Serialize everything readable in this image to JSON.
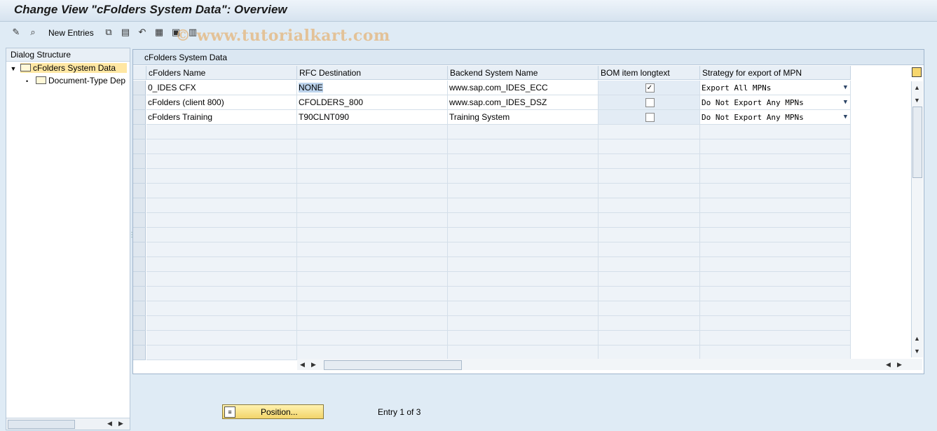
{
  "window": {
    "title": "Change View \"cFolders System Data\": Overview"
  },
  "toolbar": {
    "new_entries": "New Entries",
    "watermark": "© www.tutorialkart.com"
  },
  "dialog": {
    "header": "Dialog Structure",
    "items": [
      {
        "label": "cFolders System Data"
      },
      {
        "label": "Document-Type Dep"
      }
    ]
  },
  "table": {
    "title": "cFolders System Data",
    "columns": [
      "cFolders Name",
      "RFC Destination",
      "Backend System Name",
      "BOM item longtext",
      "Strategy for export of MPN"
    ],
    "rows": [
      {
        "name": "0_IDES CFX",
        "rfc": "NONE",
        "backend": "www.sap.com_IDES_ECC",
        "bom": true,
        "strategy": "Export All MPNs"
      },
      {
        "name": "cFolders (client 800)",
        "rfc": "CFOLDERS_800",
        "backend": "www.sap.com_IDES_DSZ",
        "bom": false,
        "strategy": "Do Not Export Any MPNs"
      },
      {
        "name": "cFolders Training",
        "rfc": "T90CLNT090",
        "backend": "Training System",
        "bom": false,
        "strategy": "Do Not Export Any MPNs"
      }
    ]
  },
  "footer": {
    "position_label": "Position...",
    "entry_text": "Entry 1 of 3"
  }
}
